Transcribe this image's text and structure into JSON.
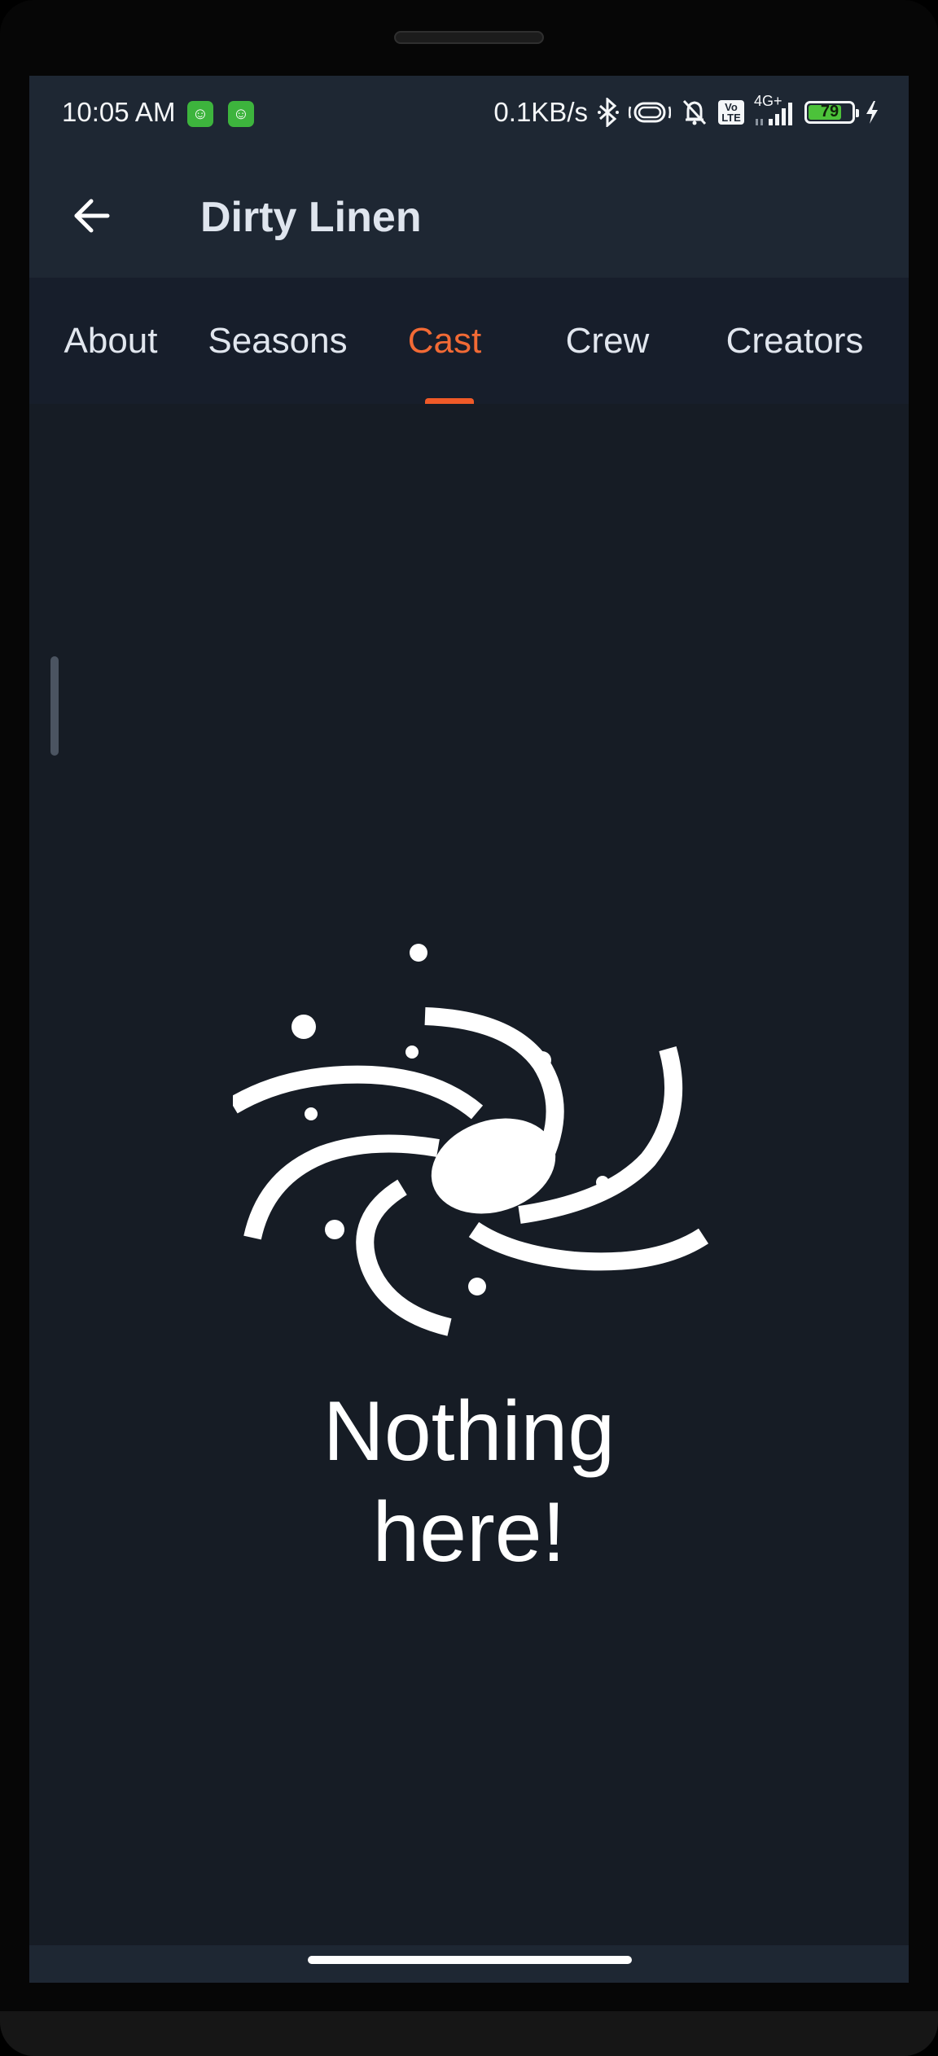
{
  "status_bar": {
    "time": "10:05 AM",
    "network_speed": "0.1KB/s",
    "network_type": "4G+",
    "volte_label": "Vo\nLTE",
    "battery_percent": "79",
    "battery_level": 0.79,
    "notification_icons": [
      "app-notification-icon",
      "app-notification-icon"
    ],
    "icons": [
      "bluetooth-icon",
      "vibrate-icon",
      "mute-icon",
      "volte-icon",
      "signal-icon",
      "battery-icon",
      "charging-icon"
    ]
  },
  "app_bar": {
    "title": "Dirty Linen",
    "back_icon": "arrow-left-icon"
  },
  "tabs": [
    {
      "label": "About",
      "active": false
    },
    {
      "label": "Seasons",
      "active": false
    },
    {
      "label": "Cast",
      "active": true
    },
    {
      "label": "Crew",
      "active": false
    },
    {
      "label": "Creators",
      "active": false
    }
  ],
  "empty_state": {
    "icon": "galaxy-icon",
    "line1": "Nothing",
    "line2": "here!"
  },
  "colors": {
    "accent": "#f05a28",
    "background": "#161c25",
    "app_bar": "#1e2733",
    "tab_bar": "#171e2b"
  }
}
